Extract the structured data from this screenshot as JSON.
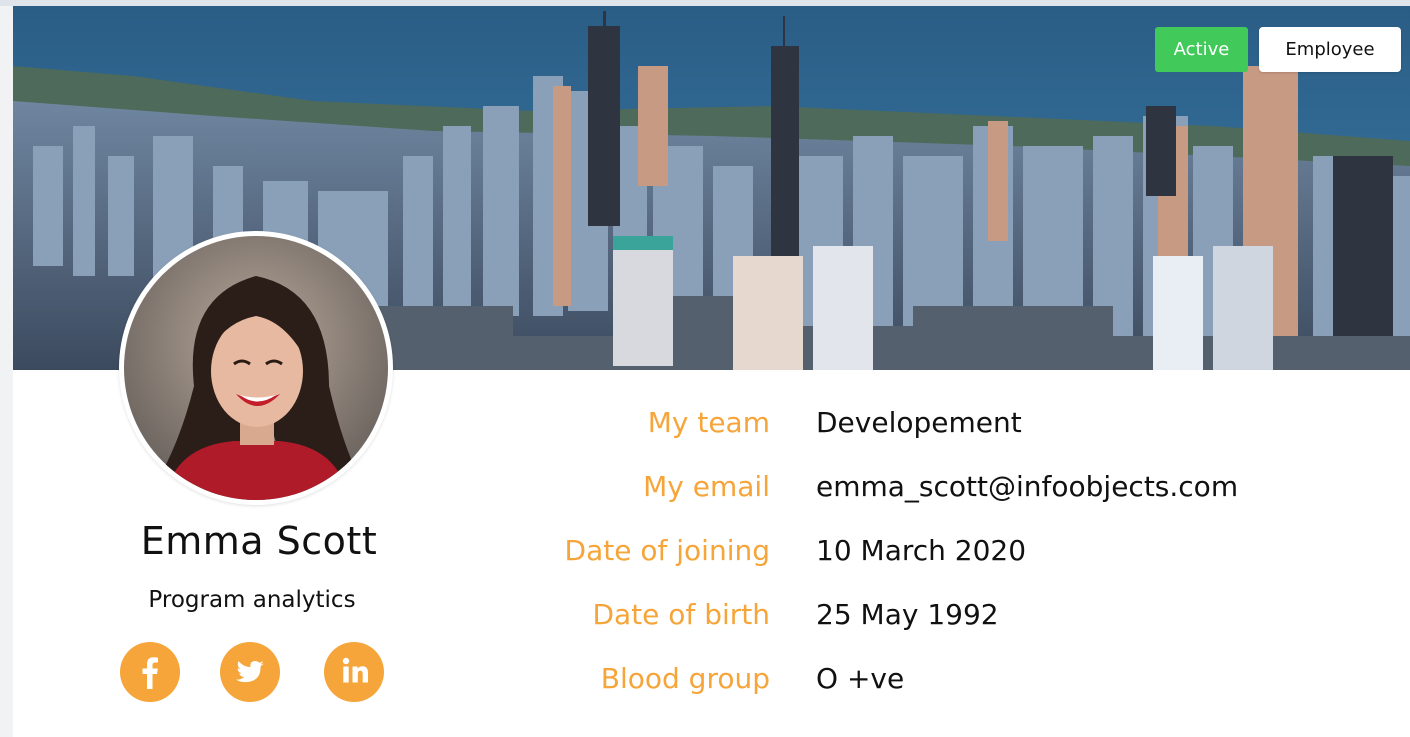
{
  "profile": {
    "status_badge": "Active",
    "type_badge": "Employee",
    "name": "Emma Scott",
    "role": "Program analytics"
  },
  "social": [
    {
      "icon": "facebook-icon"
    },
    {
      "icon": "twitter-icon"
    },
    {
      "icon": "linkedin-icon"
    }
  ],
  "details": [
    {
      "label": "My team",
      "value": "Developement"
    },
    {
      "label": "My email",
      "value": "emma_scott@infoobjects.com"
    },
    {
      "label": "Date of joining",
      "value": "10 March 2020"
    },
    {
      "label": "Date of birth",
      "value": "25 May 1992"
    },
    {
      "label": "Blood group",
      "value": "O +ve"
    }
  ],
  "colors": {
    "accent": "#f5a53a",
    "active": "#41c95a",
    "text": "#111111",
    "background": "#ffffff"
  }
}
